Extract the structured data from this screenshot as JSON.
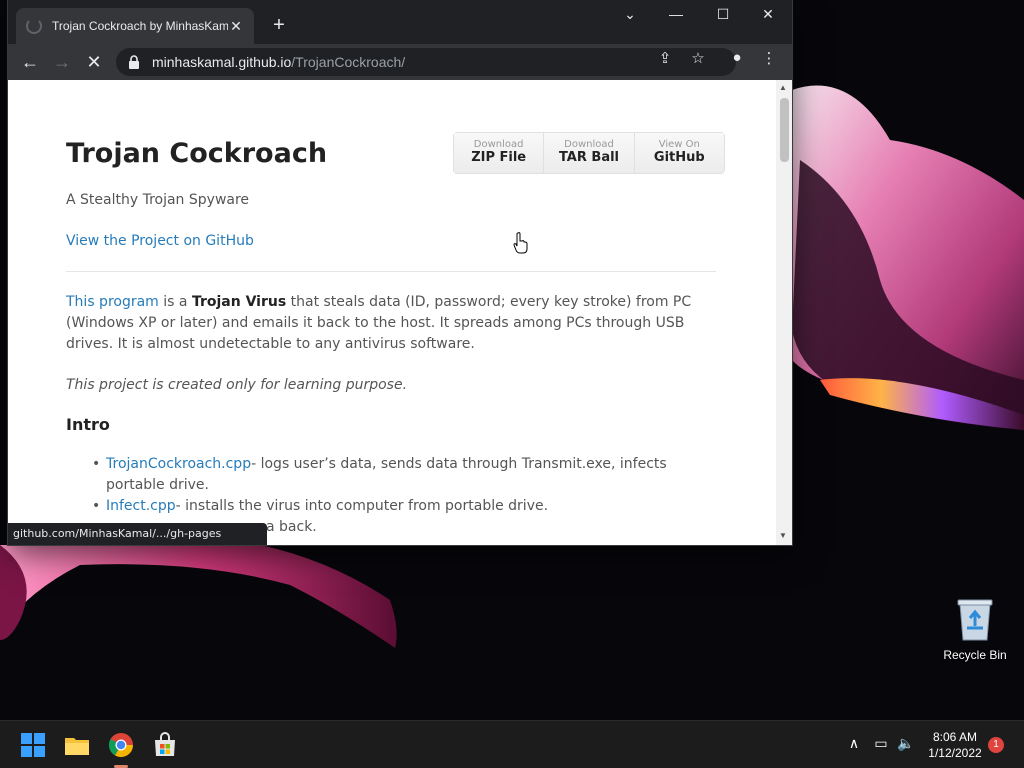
{
  "browser": {
    "tab_title": "Trojan Cockroach by MinhasKamal",
    "url_host": "minhaskamal.github.io",
    "url_path": "/TrojanCockroach/",
    "status_url": "github.com/MinhasKamal/.../gh-pages"
  },
  "page": {
    "title": "Trojan Cockroach",
    "subtitle": "A Stealthy Trojan Spyware",
    "project_link": "View the Project on GitHub",
    "downloads": [
      {
        "small": "Download",
        "big": "ZIP File"
      },
      {
        "small": "Download",
        "big": "TAR Ball"
      },
      {
        "small": "View On",
        "big": "GitHub"
      }
    ],
    "intro_para": {
      "link": "This program",
      "text1": " is a ",
      "bold": "Trojan Virus",
      "text2": " that steals data (ID, password; every key stroke) from PC (Windows XP or later) and emails it back to the host. It spreads among PCs through USB drives. It is almost undetectable to any antivirus software."
    },
    "note": "This project is created only for learning purpose.",
    "intro_heading": "Intro",
    "list": [
      {
        "link": "TrojanCockroach.cpp",
        "text": "- logs user’s data, sends data through Transmit.exe, infects portable drive."
      },
      {
        "link": "Infect.cpp",
        "text": "- installs the virus into computer from portable drive."
      },
      {
        "link": "",
        "text": "a back."
      }
    ]
  },
  "desktop": {
    "recycle_bin_label": "Recycle Bin"
  },
  "taskbar": {
    "time": "8:06 AM",
    "date": "1/12/2022",
    "notification_count": "1"
  },
  "colors": {
    "link": "#267CB9",
    "chrome_dark": "#202124",
    "chrome_toolbar": "#35363a"
  }
}
